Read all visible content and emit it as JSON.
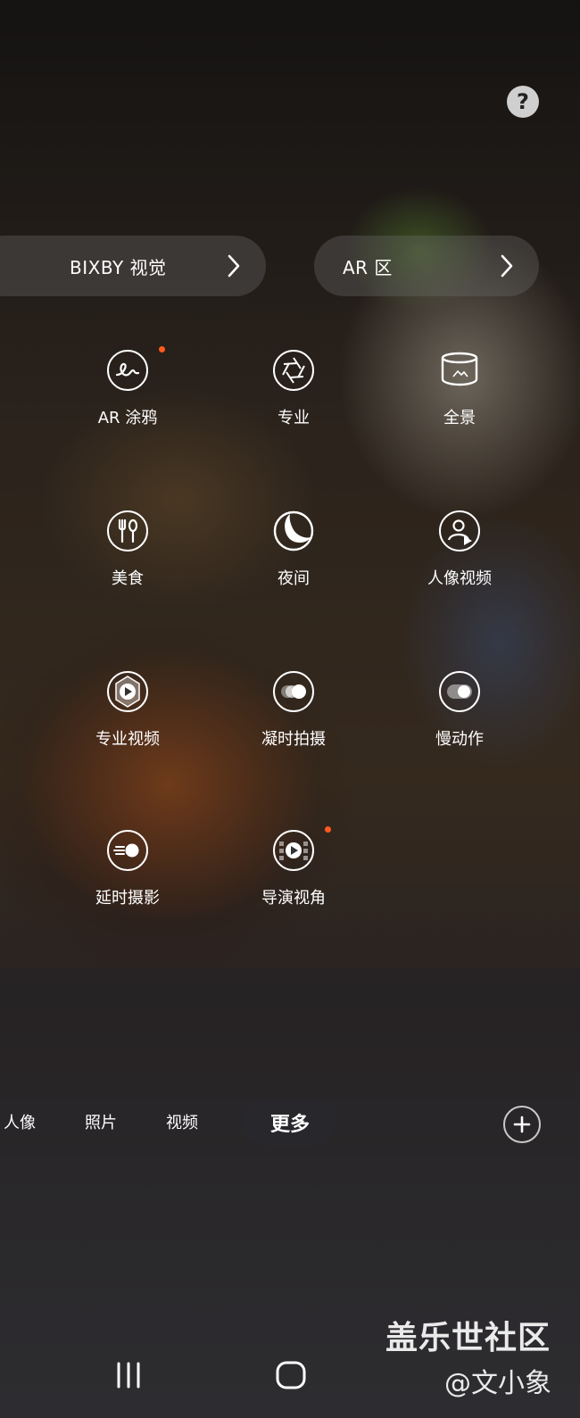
{
  "header": {
    "help_symbol": "?"
  },
  "shortcuts": {
    "bixby_label": "BIXBY 视觉",
    "ar_zone_label": "AR 区"
  },
  "modes": [
    {
      "id": "ar-doodle",
      "label": "AR 涂鸦",
      "icon": "doodle-icon",
      "new": true
    },
    {
      "id": "pro",
      "label": "专业",
      "icon": "aperture-icon",
      "new": false
    },
    {
      "id": "panorama",
      "label": "全景",
      "icon": "panorama-icon",
      "new": false
    },
    {
      "id": "food",
      "label": "美食",
      "icon": "fork-spoon-icon",
      "new": false
    },
    {
      "id": "night",
      "label": "夜间",
      "icon": "moon-icon",
      "new": false
    },
    {
      "id": "portrait-video",
      "label": "人像视频",
      "icon": "portrait-video-icon",
      "new": false
    },
    {
      "id": "pro-video",
      "label": "专业视频",
      "icon": "pro-video-icon",
      "new": false
    },
    {
      "id": "hyperlapse-capture",
      "label": "凝时拍摄",
      "icon": "toggle-motion-icon",
      "new": false
    },
    {
      "id": "slow-motion",
      "label": "慢动作",
      "icon": "slow-motion-icon",
      "new": false
    },
    {
      "id": "hyperlapse",
      "label": "延时摄影",
      "icon": "hyperlapse-icon",
      "new": false
    },
    {
      "id": "directors-view",
      "label": "导演视角",
      "icon": "film-play-icon",
      "new": true
    }
  ],
  "mode_bar": {
    "items": [
      "人像",
      "照片",
      "视频"
    ],
    "active": "更多",
    "add_symbol": "+"
  },
  "watermark": {
    "line1": "盖乐世社区",
    "line2": "@文小象"
  },
  "colors": {
    "new_dot": "#ff5a1f",
    "help_bg": "#cfcfcf"
  }
}
